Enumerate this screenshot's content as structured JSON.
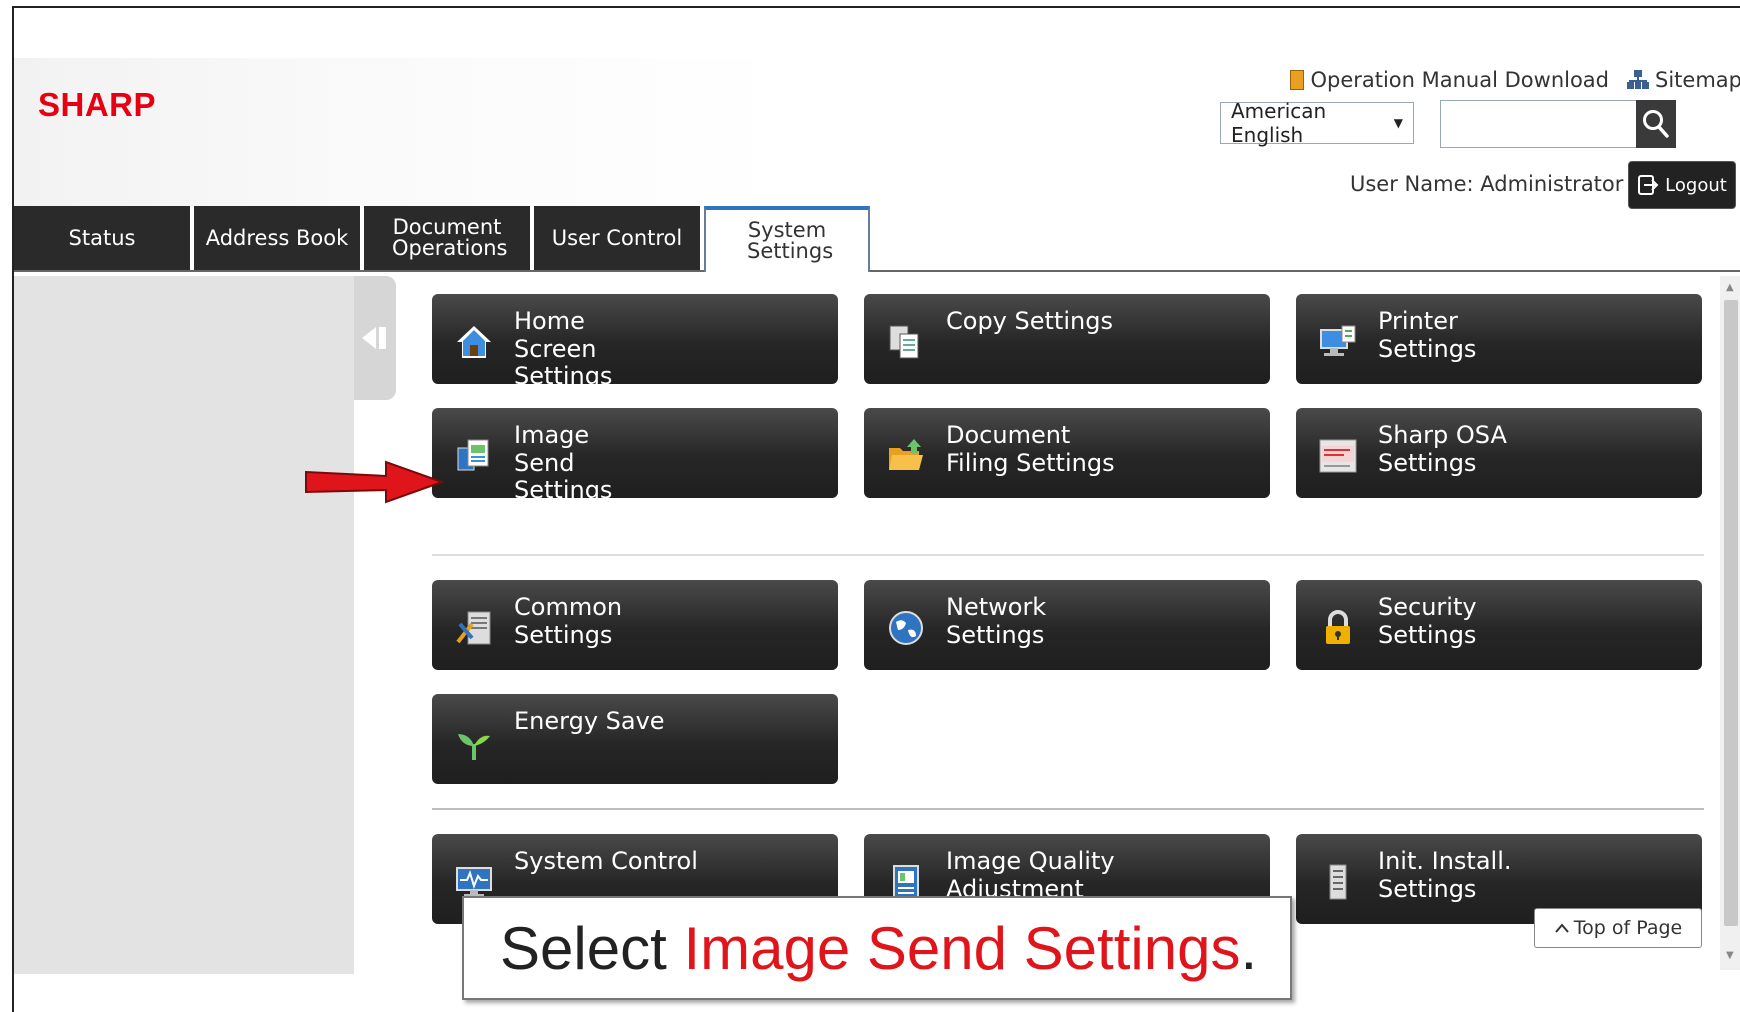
{
  "header": {
    "logo": "SHARP",
    "logo_color": "#e60012",
    "links": {
      "manual": "Operation Manual Download",
      "sitemap": "Sitemap"
    },
    "language": "American English",
    "search_placeholder": "",
    "user_name": "User Name: Administrator",
    "logout": "Logout"
  },
  "tabs": [
    {
      "label": "Status"
    },
    {
      "label": "Address Book"
    },
    {
      "label": "Document Operations"
    },
    {
      "label": "User Control"
    },
    {
      "label": "System Settings",
      "active": true
    }
  ],
  "tiles": {
    "home_screen": "Home Screen Settings",
    "copy": "Copy Settings",
    "printer": "Printer Settings",
    "image_send": "Image Send Settings",
    "document_filing": "Document Filing Settings",
    "sharp_osa": "Sharp OSA Settings",
    "common": "Common Settings",
    "network": "Network Settings",
    "security": "Security Settings",
    "energy_save": "Energy Save",
    "system_control": "System Control",
    "image_quality": "Image Quality Adjustment",
    "init_install": "Init. Install. Settings"
  },
  "top_of_page": "Top of Page",
  "callout": {
    "prefix": "Select ",
    "highlight": "Image Send Settings",
    "suffix": ".",
    "highlight_color": "#e0151b"
  }
}
